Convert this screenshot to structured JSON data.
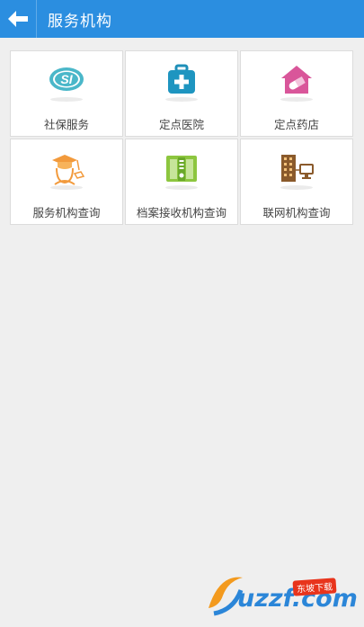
{
  "header": {
    "title": "服务机构"
  },
  "tiles": [
    {
      "label": "社保服务",
      "icon": "social-security-icon"
    },
    {
      "label": "定点医院",
      "icon": "medical-kit-icon"
    },
    {
      "label": "定点药店",
      "icon": "pharmacy-icon"
    },
    {
      "label": "服务机构查询",
      "icon": "graduate-icon"
    },
    {
      "label": "档案接收机构查询",
      "icon": "archive-cabinet-icon"
    },
    {
      "label": "联网机构查询",
      "icon": "network-building-icon"
    }
  ],
  "watermark": {
    "site": "uzzf.com",
    "badge": "东坡下载"
  },
  "colors": {
    "appbar": "#2b8ee0",
    "background": "#efefef",
    "tile": "#ffffff"
  }
}
